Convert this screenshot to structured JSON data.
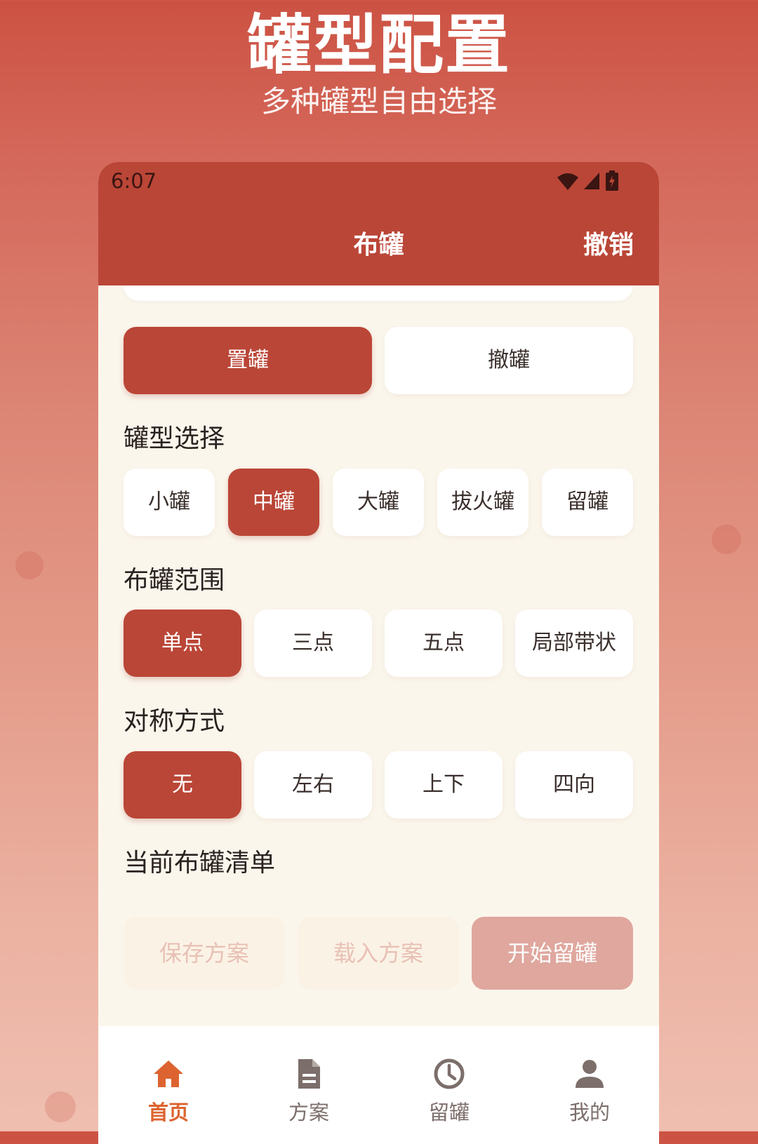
{
  "promo": {
    "title": "罐型配置",
    "subtitle": "多种罐型自由选择"
  },
  "status_bar": {
    "time": "6:07",
    "icons": [
      "wifi-icon",
      "signal-icon",
      "battery-charging-icon"
    ]
  },
  "header": {
    "title": "布罐",
    "action": "撤销"
  },
  "mode_buttons": [
    {
      "label": "置罐",
      "selected": true
    },
    {
      "label": "撤罐",
      "selected": false
    }
  ],
  "sections": {
    "cup_type": {
      "title": "罐型选择",
      "options": [
        {
          "label": "小罐",
          "selected": false
        },
        {
          "label": "中罐",
          "selected": true
        },
        {
          "label": "大罐",
          "selected": false
        },
        {
          "label": "拔火罐",
          "selected": false
        },
        {
          "label": "留罐",
          "selected": false
        }
      ]
    },
    "range": {
      "title": "布罐范围",
      "options": [
        {
          "label": "单点",
          "selected": true
        },
        {
          "label": "三点",
          "selected": false
        },
        {
          "label": "五点",
          "selected": false
        },
        {
          "label": "局部带状",
          "selected": false
        }
      ]
    },
    "symmetry": {
      "title": "对称方式",
      "options": [
        {
          "label": "无",
          "selected": true
        },
        {
          "label": "左右",
          "selected": false
        },
        {
          "label": "上下",
          "selected": false
        },
        {
          "label": "四向",
          "selected": false
        }
      ]
    },
    "list": {
      "title": "当前布罐清单"
    }
  },
  "actions": {
    "save": "保存方案",
    "load": "载入方案",
    "start": "开始留罐"
  },
  "tabs": [
    {
      "label": "首页",
      "icon": "home-icon",
      "active": true
    },
    {
      "label": "方案",
      "icon": "document-icon",
      "active": false
    },
    {
      "label": "留罐",
      "icon": "clock-icon",
      "active": false
    },
    {
      "label": "我的",
      "icon": "user-icon",
      "active": false
    }
  ],
  "colors": {
    "primary": "#ba4637",
    "active_tab": "#dd6430",
    "background": "#fbf6ec",
    "disabled_text": "#e8c1b4",
    "disabled_primary": "#dfa79e"
  }
}
